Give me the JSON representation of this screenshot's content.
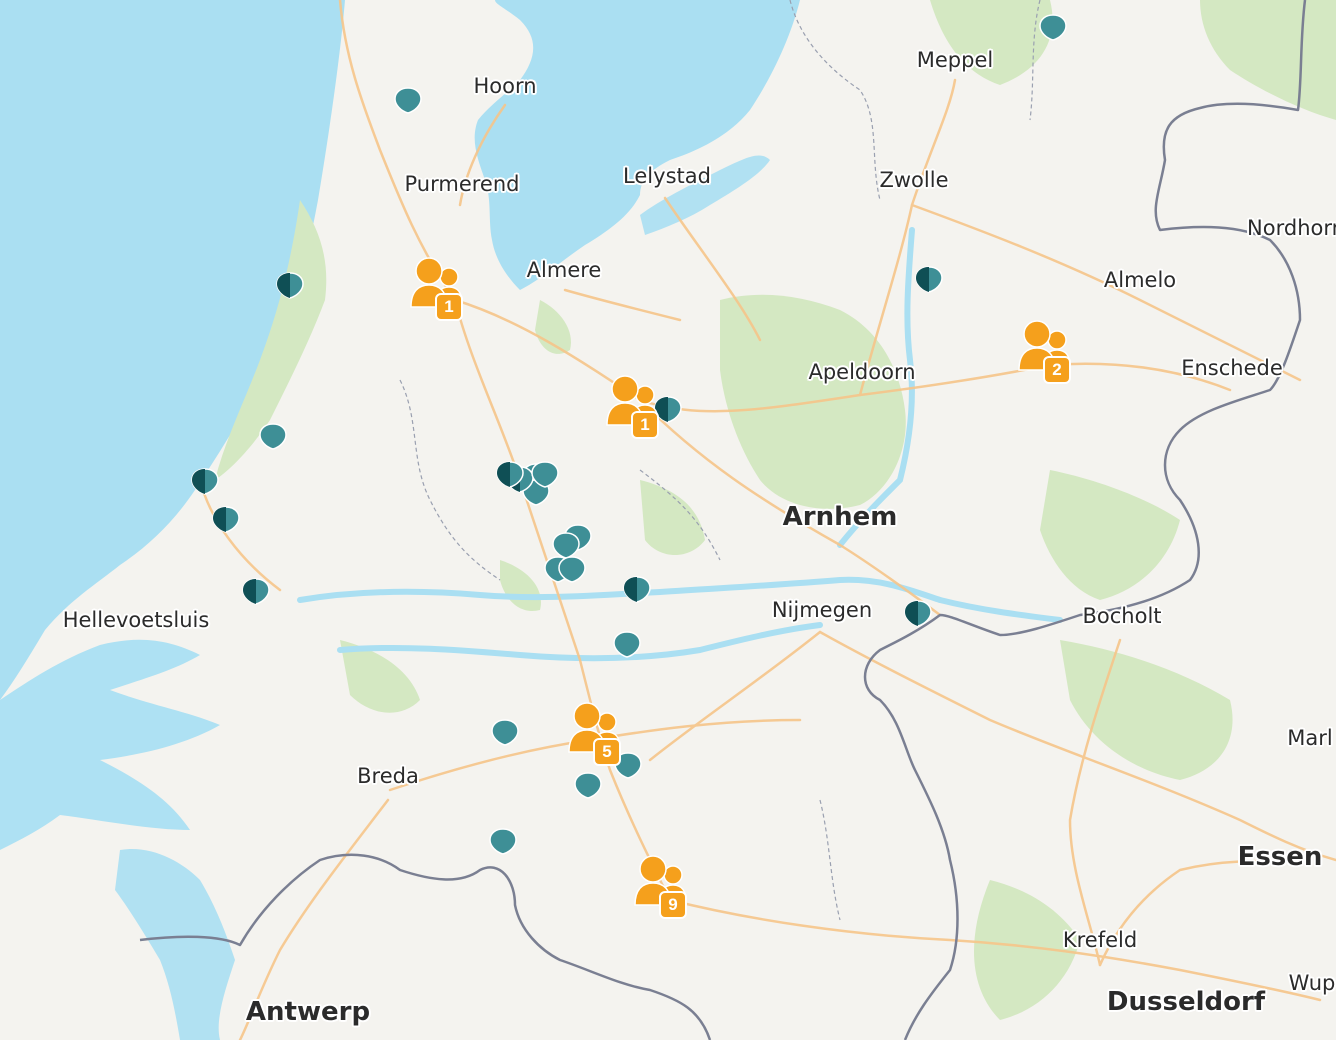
{
  "colors": {
    "sea": "#aadff2",
    "land": "#f4f3ef",
    "forest": "#d4e8c2",
    "road": "#f6c58a",
    "border": "#7a7f92",
    "marker_teal": "#3e8f96",
    "marker_dark": "#0f4f55",
    "cluster_orange": "#f5a01c"
  },
  "cities": [
    {
      "name": "Hoorn"
    },
    {
      "name": "Meppel"
    },
    {
      "name": "Purmerend"
    },
    {
      "name": "Lelystad"
    },
    {
      "name": "Zwolle"
    },
    {
      "name": "Almere"
    },
    {
      "name": "Almelo"
    },
    {
      "name": "Nordhorn"
    },
    {
      "name": "Apeldoorn"
    },
    {
      "name": "Enschede"
    },
    {
      "name": "Arnhem"
    },
    {
      "name": "Nijmegen"
    },
    {
      "name": "Bocholt"
    },
    {
      "name": "Hellevoetsluis"
    },
    {
      "name": "Breda"
    },
    {
      "name": "Marl"
    },
    {
      "name": "Essen"
    },
    {
      "name": "Krefeld"
    },
    {
      "name": "Wup"
    },
    {
      "name": "Antwerp"
    },
    {
      "name": "Dusseldorf"
    }
  ],
  "markers": [
    {
      "icon": "location-pin-icon",
      "style": "teal"
    },
    {
      "icon": "location-pin-icon",
      "style": "split"
    },
    {
      "icon": "location-pin-icon",
      "style": "split"
    },
    {
      "icon": "location-pin-icon",
      "style": "teal"
    },
    {
      "icon": "location-pin-icon",
      "style": "teal"
    },
    {
      "icon": "location-pin-icon",
      "style": "split"
    },
    {
      "icon": "location-pin-icon",
      "style": "split"
    },
    {
      "icon": "location-pin-icon",
      "style": "split"
    },
    {
      "icon": "location-pin-icon",
      "style": "teal"
    },
    {
      "icon": "location-pin-icon",
      "style": "teal"
    },
    {
      "icon": "location-pin-icon",
      "style": "split"
    },
    {
      "icon": "location-pin-icon",
      "style": "split"
    },
    {
      "icon": "location-pin-icon",
      "style": "teal"
    },
    {
      "icon": "location-pin-icon",
      "style": "teal"
    },
    {
      "icon": "location-pin-icon",
      "style": "teal"
    },
    {
      "icon": "location-pin-icon",
      "style": "split"
    },
    {
      "icon": "location-pin-icon",
      "style": "split"
    },
    {
      "icon": "location-pin-icon",
      "style": "teal"
    },
    {
      "icon": "location-pin-icon",
      "style": "split"
    },
    {
      "icon": "location-pin-icon",
      "style": "teal"
    },
    {
      "icon": "location-pin-icon",
      "style": "teal"
    },
    {
      "icon": "location-pin-icon",
      "style": "teal"
    },
    {
      "icon": "location-pin-icon",
      "style": "teal"
    },
    {
      "icon": "location-pin-icon",
      "style": "teal"
    },
    {
      "icon": "location-pin-icon",
      "style": "teal"
    }
  ],
  "clusters": [
    {
      "icon": "people-group-icon",
      "count": "1"
    },
    {
      "icon": "people-group-icon",
      "count": "1"
    },
    {
      "icon": "people-group-icon",
      "count": "2"
    },
    {
      "icon": "people-group-icon",
      "count": "5"
    },
    {
      "icon": "people-group-icon",
      "count": "9"
    }
  ]
}
